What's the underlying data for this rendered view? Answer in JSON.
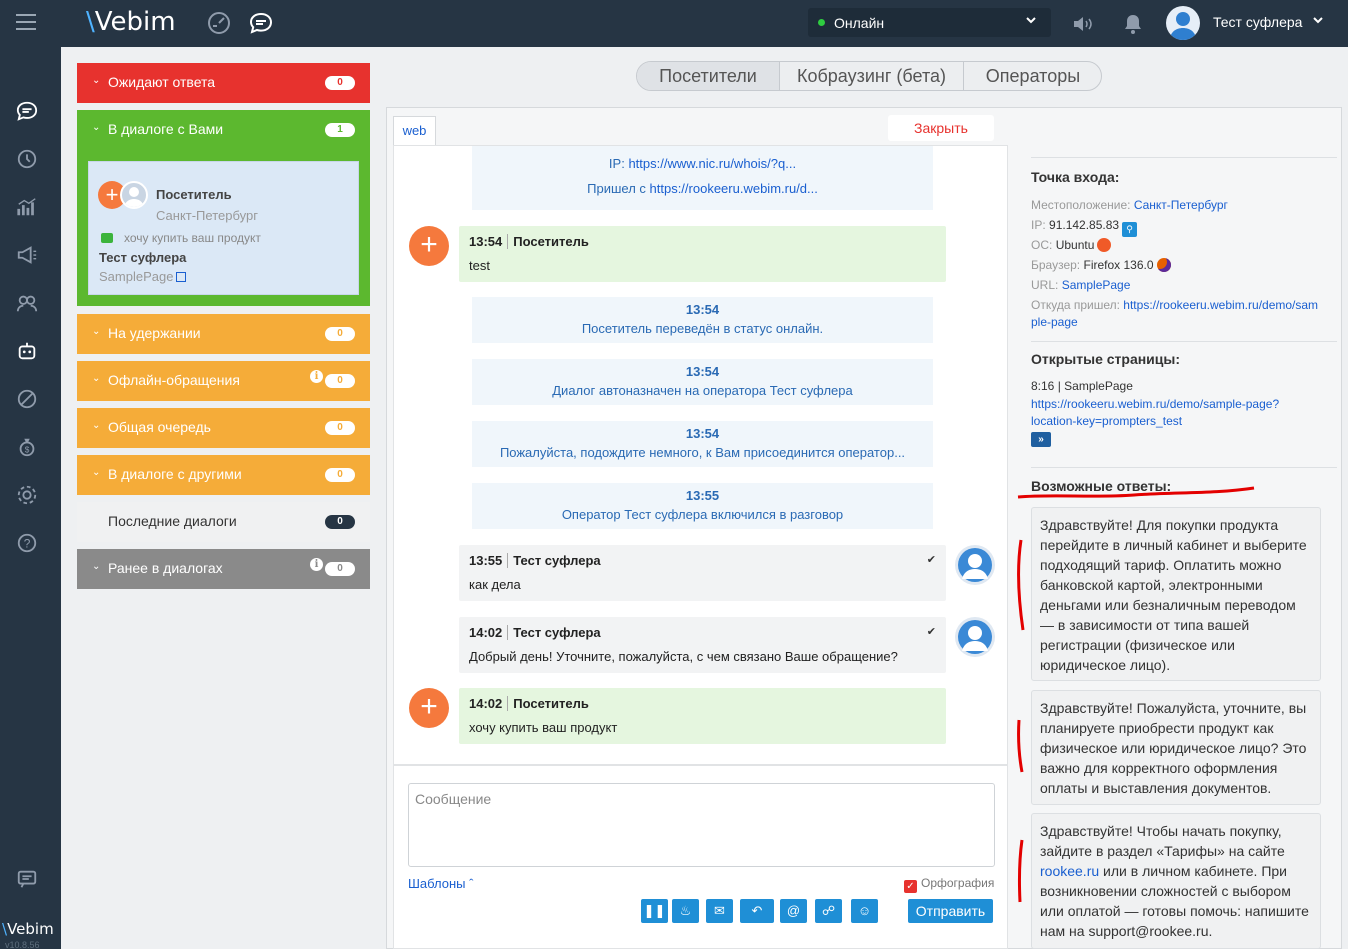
{
  "header": {
    "logo": "Vebim",
    "status": "Онлайн",
    "user": "Тест суфлера"
  },
  "rail": {
    "logo": "Vebim",
    "version": "v10.8.56"
  },
  "groups": {
    "waiting": {
      "label": "Ожидают ответа",
      "count": "0"
    },
    "with_you": {
      "label": "В диалоге с Вами",
      "count": "1"
    },
    "on_hold": {
      "label": "На удержании",
      "count": "0"
    },
    "offline": {
      "label": "Офлайн-обращения",
      "count": "0"
    },
    "queue": {
      "label": "Общая очередь",
      "count": "0"
    },
    "with_others": {
      "label": "В диалоге с другими",
      "count": "0"
    },
    "recent": {
      "label": "Последние диалоги",
      "count": "0"
    },
    "earlier": {
      "label": "Ранее в диалогах",
      "count": "0"
    }
  },
  "dialog_card": {
    "name": "Посетитель",
    "city": "Санкт-Петербург",
    "message": "хочу купить ваш продукт",
    "operator": "Тест суфлера",
    "page": "SamplePage"
  },
  "tabs": [
    "Посетители",
    "Кобраузинг (бета)",
    "Операторы"
  ],
  "chat": {
    "tab": "web",
    "close": "Закрыть",
    "ip_label": "IP:",
    "ip_link": "https://www.nic.ru/whois/?q...",
    "from_label": "Пришел с",
    "from_link": "https://rookeeru.webim.ru/d...",
    "messages": [
      {
        "time": "13:54",
        "author": "Посетитель",
        "text": "test"
      },
      {
        "time": "13:55",
        "author": "Тест суфлера",
        "text": "как дела"
      },
      {
        "time": "14:02",
        "author": "Тест суфлера",
        "text": "Добрый день! Уточните, пожалуйста, с чем связано Ваше обращение?"
      },
      {
        "time": "14:02",
        "author": "Посетитель",
        "text": "хочу купить ваш продукт"
      }
    ],
    "system": [
      {
        "time": "13:54",
        "text": "Посетитель переведён в статус онлайн."
      },
      {
        "time": "13:54",
        "text": "Диалог автоназначен на оператора Тест суфлера"
      },
      {
        "time": "13:54",
        "text": "Пожалуйста, подождите немного, к Вам присоединится оператор..."
      },
      {
        "time": "13:55",
        "text": "Оператор Тест суфлера включился в разговор"
      }
    ],
    "input_placeholder": "Сообщение",
    "templates": "Шаблоны",
    "spellcheck": "Орфография",
    "send": "Отправить"
  },
  "visitor_info": {
    "entry_title": "Точка входа:",
    "location_label": "Местоположение:",
    "location": "Санкт-Петербург",
    "ip_label": "IP:",
    "ip": "91.142.85.83",
    "os_label": "ОС:",
    "os": "Ubuntu",
    "browser_label": "Браузер:",
    "browser": "Firefox 136.0",
    "url_label": "URL:",
    "url": "SamplePage",
    "referrer_label": "Откуда пришел:",
    "referrer_1": "https://rookeeru.webim.ru/demo/sam",
    "referrer_2": "ple-page",
    "pages_title": "Открытые страницы:",
    "page_time": "8:16",
    "page_name": "SamplePage",
    "page_link_1": "https://rookeeru.webim.ru/demo/sample-page?",
    "page_link_2": "location-key=prompters_test",
    "more": "»"
  },
  "answers": {
    "title": "Возможные ответы:",
    "a1": "Здравствуйте! Для покупки продукта перейдите в личный кабинет и выберите подходящий тариф. Оплатить можно банковской картой, электронными деньгами или безналичным переводом — в зависимости от типа вашей регистрации (физическое или юридическое лицо).",
    "a2": "Здравствуйте! Пожалуйста, уточните, вы планируете приобрести продукт как физическое или юридическое лицо? Это важно для корректного оформления оплаты и выставления документов.",
    "a3_part1": "Здравствуйте! Чтобы начать покупку, зайдите в раздел «Тарифы» на сайте",
    "a3_link": "rookee.ru",
    "a3_part2": "или в личном кабинете. При возникновении сложностей с выбором или оплатой — готовы помочь: напишите нам на support@rookee.ru."
  }
}
